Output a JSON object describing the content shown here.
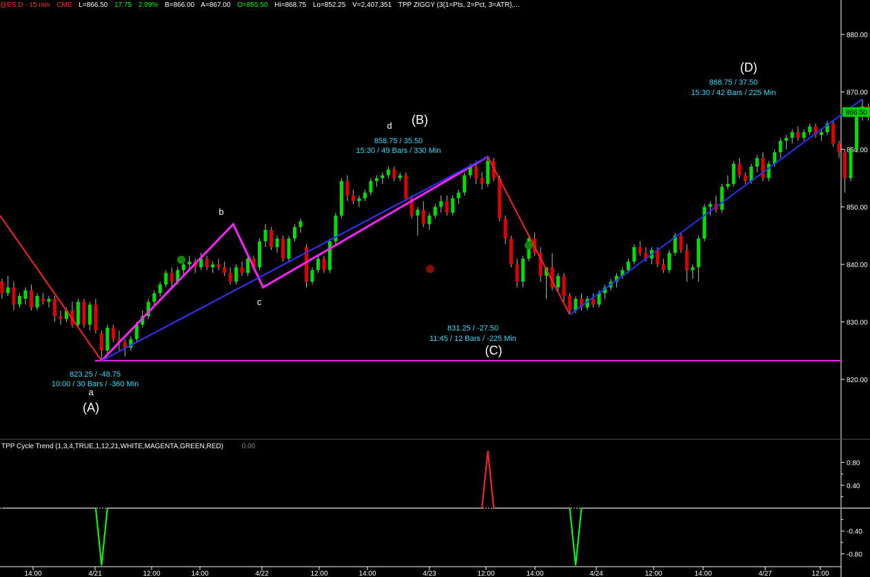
{
  "header": {
    "symbol": "@ES.D - 15 min",
    "exchange": "CME",
    "last": "L=866.50",
    "change": "17.75",
    "change_pct": "2.09%",
    "bid": "B=866.00",
    "ask": "A=867.00",
    "open": "O=855.50",
    "high": "Hi=868.75",
    "low": "Lo=852.25",
    "volume": "V=2,407,351",
    "study": "TPP ZIGGY (3{1=Pts, 2=Pct, 3=ATR},..."
  },
  "indicator": {
    "title": "TPP Cycle Trend (1,3,4,TRUE,1,12,21,WHITE,MAGENTA,GREEN,RED)",
    "value": "0.00"
  },
  "colors": {
    "background": "#000000",
    "up_candle": "#00e000",
    "down_candle": "#e00000",
    "zigzag": "#ff2020",
    "abcd": "#ff22ff",
    "trend": "#2233ff",
    "support": "#ff22ff",
    "label_cyan": "#33ddff",
    "axis": "#ffffff",
    "last_price_bg": "#00cc00"
  },
  "chart_data": [
    {
      "type": "candlestick",
      "timeframe": "15 min",
      "ylim": [
        810,
        888
      ],
      "y_ticks": [
        "880.00",
        "870.00",
        "860.00",
        "850.00",
        "840.00",
        "830.00",
        "820.00"
      ],
      "x_ticks": [
        "14:00",
        "4/21",
        "12:00",
        "14:00",
        "4/22",
        "12:00",
        "14:00",
        "4/23",
        "12:00",
        "14:00",
        "4/24",
        "12:00",
        "14:00",
        "4/27",
        "12:00"
      ],
      "last_price_label": "866.50",
      "support_line": 823.25,
      "swings": [
        {
          "name": "(A)",
          "minor": "a",
          "price": 823.25,
          "line1": "823.25 / -48.75",
          "line2": "10:00 / 30 Bars / -360 Min"
        },
        {
          "name": "b",
          "price": 847.0
        },
        {
          "name": "c",
          "price": 836.0
        },
        {
          "name": "(B)",
          "minor": "d",
          "price": 858.75,
          "line1": "858.75 / 35.50",
          "line2": "15:30 / 49 Bars / 330 Min"
        },
        {
          "name": "(C)",
          "price": 831.25,
          "line1": "831.25 / -27.50",
          "line2": "11:45 / 12 Bars / -225 Min"
        },
        {
          "name": "(D)",
          "price": 868.75,
          "line1": "868.75 / 37.50",
          "line2": "15:30 / 42 Bars / 225 Min"
        }
      ],
      "ohlc": [
        [
          837.0,
          837.5,
          834.0,
          835.0
        ],
        [
          835.0,
          838.0,
          834.5,
          836.0
        ],
        [
          836.0,
          837.0,
          832.0,
          833.0
        ],
        [
          833.0,
          835.0,
          832.5,
          834.5
        ],
        [
          834.0,
          836.0,
          833.0,
          835.5
        ],
        [
          835.5,
          836.5,
          832.0,
          832.5
        ],
        [
          832.5,
          835.0,
          832.0,
          834.5
        ],
        [
          834.0,
          835.0,
          833.0,
          833.5
        ],
        [
          833.5,
          834.5,
          832.5,
          834.0
        ],
        [
          834.0,
          834.5,
          830.0,
          831.0
        ],
        [
          831.0,
          832.0,
          829.5,
          830.5
        ],
        [
          830.5,
          832.5,
          830.0,
          832.0
        ],
        [
          832.0,
          833.5,
          829.0,
          829.5
        ],
        [
          829.5,
          834.0,
          829.0,
          833.5
        ],
        [
          833.5,
          834.0,
          829.0,
          829.5
        ],
        [
          829.5,
          833.5,
          828.5,
          833.0
        ],
        [
          833.0,
          834.0,
          828.0,
          828.5
        ],
        [
          828.0,
          828.5,
          823.25,
          825.0
        ],
        [
          825.0,
          829.5,
          824.5,
          829.0
        ],
        [
          829.0,
          829.5,
          826.5,
          827.0
        ],
        [
          827.0,
          828.5,
          825.0,
          826.5
        ],
        [
          826.5,
          827.0,
          824.0,
          825.5
        ],
        [
          825.5,
          827.5,
          825.0,
          827.0
        ],
        [
          827.0,
          830.0,
          826.5,
          829.5
        ],
        [
          829.5,
          832.0,
          829.0,
          831.0
        ],
        [
          831.0,
          834.0,
          830.5,
          833.5
        ],
        [
          833.5,
          835.5,
          833.0,
          835.0
        ],
        [
          835.0,
          837.0,
          834.5,
          836.5
        ],
        [
          836.5,
          839.0,
          836.0,
          838.5
        ],
        [
          838.5,
          839.5,
          836.0,
          837.0
        ],
        [
          837.0,
          839.5,
          836.5,
          839.0
        ],
        [
          839.0,
          840.5,
          838.0,
          840.0
        ],
        [
          840.0,
          841.5,
          839.0,
          840.5
        ],
        [
          840.5,
          841.0,
          838.5,
          839.5
        ],
        [
          839.5,
          842.0,
          839.0,
          841.0
        ],
        [
          841.0,
          841.5,
          839.0,
          839.5
        ],
        [
          839.5,
          840.5,
          838.5,
          840.0
        ],
        [
          840.0,
          841.0,
          839.0,
          839.5
        ],
        [
          839.5,
          840.5,
          838.0,
          838.5
        ],
        [
          838.5,
          839.5,
          836.5,
          837.0
        ],
        [
          837.0,
          840.0,
          836.5,
          839.5
        ],
        [
          839.5,
          840.5,
          838.0,
          838.5
        ],
        [
          838.5,
          841.5,
          838.0,
          841.0
        ],
        [
          841.0,
          841.5,
          839.0,
          839.5
        ],
        [
          839.5,
          844.5,
          839.0,
          844.0
        ],
        [
          844.0,
          847.0,
          843.0,
          846.0
        ],
        [
          846.0,
          846.5,
          842.5,
          843.0
        ],
        [
          843.0,
          845.0,
          842.0,
          844.5
        ],
        [
          844.5,
          845.0,
          840.5,
          841.0
        ],
        [
          841.0,
          845.0,
          840.5,
          844.5
        ],
        [
          844.5,
          847.0,
          844.0,
          846.5
        ],
        [
          846.5,
          848.0,
          845.5,
          847.5
        ],
        [
          843.0,
          843.5,
          836.0,
          837.0
        ],
        [
          837.0,
          839.5,
          836.5,
          839.0
        ],
        [
          839.0,
          841.5,
          838.5,
          841.0
        ],
        [
          841.0,
          841.5,
          838.5,
          839.0
        ],
        [
          839.0,
          844.5,
          838.5,
          844.0
        ],
        [
          844.0,
          849.0,
          843.5,
          848.5
        ],
        [
          848.5,
          855.0,
          848.0,
          854.5
        ],
        [
          854.5,
          855.5,
          851.0,
          852.0
        ],
        [
          852.0,
          853.0,
          850.5,
          851.0
        ],
        [
          851.0,
          852.0,
          850.0,
          851.5
        ],
        [
          851.5,
          853.0,
          851.0,
          852.5
        ],
        [
          852.5,
          855.0,
          852.0,
          854.5
        ],
        [
          854.5,
          855.5,
          853.5,
          855.0
        ],
        [
          855.0,
          856.0,
          854.0,
          855.5
        ],
        [
          855.5,
          857.0,
          855.0,
          856.5
        ],
        [
          856.5,
          857.0,
          854.5,
          855.0
        ],
        [
          855.0,
          856.0,
          854.5,
          855.5
        ],
        [
          855.5,
          856.0,
          851.0,
          851.5
        ],
        [
          851.5,
          852.0,
          848.0,
          848.5
        ],
        [
          848.5,
          850.0,
          845.0,
          849.5
        ],
        [
          849.5,
          851.0,
          846.5,
          847.0
        ],
        [
          847.0,
          849.0,
          846.0,
          848.5
        ],
        [
          848.5,
          850.5,
          848.0,
          850.0
        ],
        [
          850.0,
          852.0,
          849.0,
          851.0
        ],
        [
          851.0,
          852.0,
          848.5,
          849.0
        ],
        [
          849.0,
          852.0,
          848.5,
          851.5
        ],
        [
          851.5,
          853.0,
          850.5,
          852.5
        ],
        [
          852.5,
          856.0,
          852.0,
          855.5
        ],
        [
          855.5,
          857.5,
          855.0,
          857.0
        ],
        [
          857.0,
          858.0,
          854.0,
          855.0
        ],
        [
          855.0,
          856.0,
          853.0,
          854.0
        ],
        [
          854.0,
          858.75,
          853.5,
          858.0
        ],
        [
          858.0,
          858.5,
          854.5,
          855.0
        ],
        [
          855.0,
          855.5,
          847.5,
          848.0
        ],
        [
          848.0,
          848.5,
          843.5,
          844.5
        ],
        [
          844.5,
          845.0,
          839.5,
          840.0
        ],
        [
          840.0,
          841.0,
          836.0,
          837.0
        ],
        [
          837.0,
          841.5,
          836.0,
          841.0
        ],
        [
          841.0,
          845.0,
          840.5,
          844.5
        ],
        [
          844.5,
          845.5,
          841.5,
          842.0
        ],
        [
          842.0,
          843.0,
          837.0,
          838.0
        ],
        [
          838.0,
          839.0,
          834.0,
          839.5
        ],
        [
          839.5,
          842.0,
          835.5,
          836.0
        ],
        [
          836.0,
          838.5,
          835.0,
          838.0
        ],
        [
          838.0,
          838.5,
          833.5,
          834.5
        ],
        [
          834.5,
          835.0,
          831.25,
          832.0
        ],
        [
          832.0,
          834.5,
          831.5,
          834.0
        ],
        [
          834.0,
          835.0,
          832.0,
          832.5
        ],
        [
          832.5,
          834.5,
          832.0,
          834.0
        ],
        [
          834.0,
          835.0,
          832.5,
          833.0
        ],
        [
          833.0,
          835.5,
          832.5,
          835.0
        ],
        [
          835.0,
          836.5,
          834.0,
          836.0
        ],
        [
          836.0,
          837.5,
          835.5,
          837.0
        ],
        [
          837.0,
          838.5,
          836.0,
          838.0
        ],
        [
          838.0,
          839.5,
          837.5,
          839.0
        ],
        [
          839.0,
          841.0,
          838.5,
          840.5
        ],
        [
          840.5,
          843.5,
          840.0,
          843.0
        ],
        [
          843.0,
          844.0,
          841.5,
          842.0
        ],
        [
          842.0,
          843.0,
          840.5,
          841.0
        ],
        [
          841.0,
          843.0,
          840.0,
          842.5
        ],
        [
          842.5,
          843.0,
          839.5,
          840.0
        ],
        [
          840.0,
          841.0,
          838.5,
          839.0
        ],
        [
          839.0,
          842.5,
          838.5,
          842.0
        ],
        [
          842.0,
          845.5,
          841.5,
          845.0
        ],
        [
          845.0,
          845.5,
          842.0,
          842.5
        ],
        [
          842.5,
          843.5,
          837.0,
          839.0
        ],
        [
          839.0,
          840.0,
          837.5,
          839.5
        ],
        [
          839.5,
          845.0,
          837.0,
          844.5
        ],
        [
          844.5,
          850.5,
          844.0,
          850.0
        ],
        [
          850.0,
          851.0,
          848.5,
          850.5
        ],
        [
          850.5,
          852.0,
          849.0,
          849.5
        ],
        [
          849.5,
          854.0,
          849.0,
          853.5
        ],
        [
          853.5,
          855.5,
          853.0,
          854.0
        ],
        [
          854.0,
          858.0,
          853.5,
          857.5
        ],
        [
          857.5,
          858.5,
          855.0,
          855.5
        ],
        [
          855.5,
          856.0,
          854.0,
          854.5
        ],
        [
          854.5,
          857.5,
          854.0,
          857.0
        ],
        [
          857.0,
          859.0,
          856.0,
          858.5
        ],
        [
          858.5,
          859.5,
          854.5,
          855.0
        ],
        [
          855.0,
          858.0,
          854.5,
          857.5
        ],
        [
          857.5,
          860.0,
          857.0,
          859.5
        ],
        [
          859.5,
          862.0,
          858.5,
          861.5
        ],
        [
          861.5,
          862.5,
          860.0,
          862.0
        ],
        [
          862.0,
          863.5,
          861.0,
          863.0
        ],
        [
          863.0,
          864.0,
          861.5,
          862.0
        ],
        [
          862.0,
          863.5,
          861.5,
          863.0
        ],
        [
          863.0,
          864.5,
          862.5,
          864.0
        ],
        [
          864.0,
          864.5,
          862.0,
          862.5
        ],
        [
          862.5,
          863.5,
          861.5,
          863.0
        ],
        [
          863.0,
          865.0,
          862.5,
          864.5
        ],
        [
          864.5,
          865.0,
          860.5,
          861.0
        ],
        [
          861.0,
          861.5,
          858.5,
          859.5
        ],
        [
          859.5,
          860.0,
          852.5,
          855.0
        ],
        [
          855.0,
          860.5,
          854.5,
          860.0
        ],
        [
          860.0,
          866.5,
          859.5,
          866.0
        ],
        [
          866.0,
          868.75,
          865.0,
          867.5
        ],
        [
          867.5,
          868.0,
          865.0,
          865.5
        ],
        [
          865.5,
          867.0,
          864.5,
          866.0
        ],
        [
          866.0,
          867.5,
          865.0,
          866.5
        ],
        [
          866.5,
          867.0,
          856.5,
          861.0
        ],
        [
          861.0,
          867.0,
          860.5,
          866.5
        ]
      ]
    },
    {
      "type": "line",
      "title": "TPP Cycle Trend (1,3,4,TRUE,1,12,21,WHITE,MAGENTA,GREEN,RED)",
      "ylim": [
        -0.9,
        1.0
      ],
      "y_ticks": [
        "0.80",
        "0.40",
        "-0.40",
        "-0.80"
      ],
      "baseline": 0.0,
      "spikes": [
        {
          "bar": 17,
          "value": -1.0,
          "color": "green"
        },
        {
          "bar": 83,
          "value": 1.0,
          "color": "red"
        },
        {
          "bar": 98,
          "value": -1.0,
          "color": "green"
        }
      ]
    }
  ]
}
